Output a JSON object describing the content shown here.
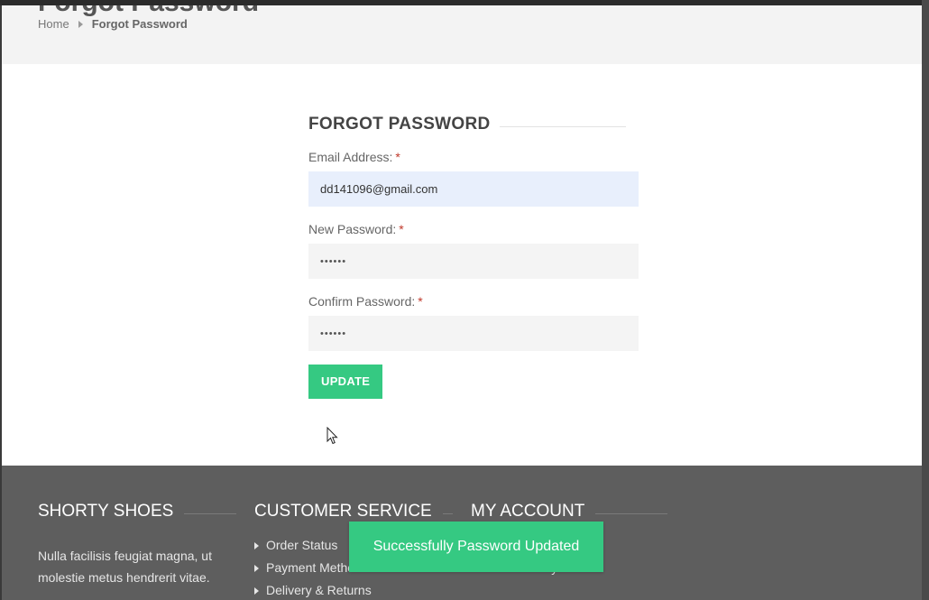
{
  "header": {
    "title": "Forgot Password",
    "breadcrumb": {
      "home": "Home",
      "current": "Forgot Password"
    }
  },
  "form": {
    "heading": "FORGOT PASSWORD",
    "email": {
      "label": "Email Address:",
      "value": "dd141096@gmail.com",
      "required_mark": "*"
    },
    "new_password": {
      "label": "New Password:",
      "value": "••••••",
      "required_mark": "*"
    },
    "confirm_password": {
      "label": "Confirm Password:",
      "value": "••••••",
      "required_mark": "*"
    },
    "submit_label": "UPDATE"
  },
  "footer": {
    "col1": {
      "title": "SHORTY SHOES",
      "text": "Nulla facilisis feugiat magna, ut molestie metus hendrerit vitae."
    },
    "col2": {
      "title": "CUSTOMER SERVICE",
      "items": [
        "Order Status",
        "Payment Methods",
        "Delivery & Returns"
      ]
    },
    "col3": {
      "title": "MY ACCOUNT",
      "items": [
        "",
        "Order History"
      ]
    }
  },
  "toast": {
    "message": "Successfully Password Updated"
  },
  "colors": {
    "accent": "#35c982",
    "footer_bg": "#5e5e5e",
    "header_bg": "#f3f3f3",
    "required": "#c0392b"
  }
}
